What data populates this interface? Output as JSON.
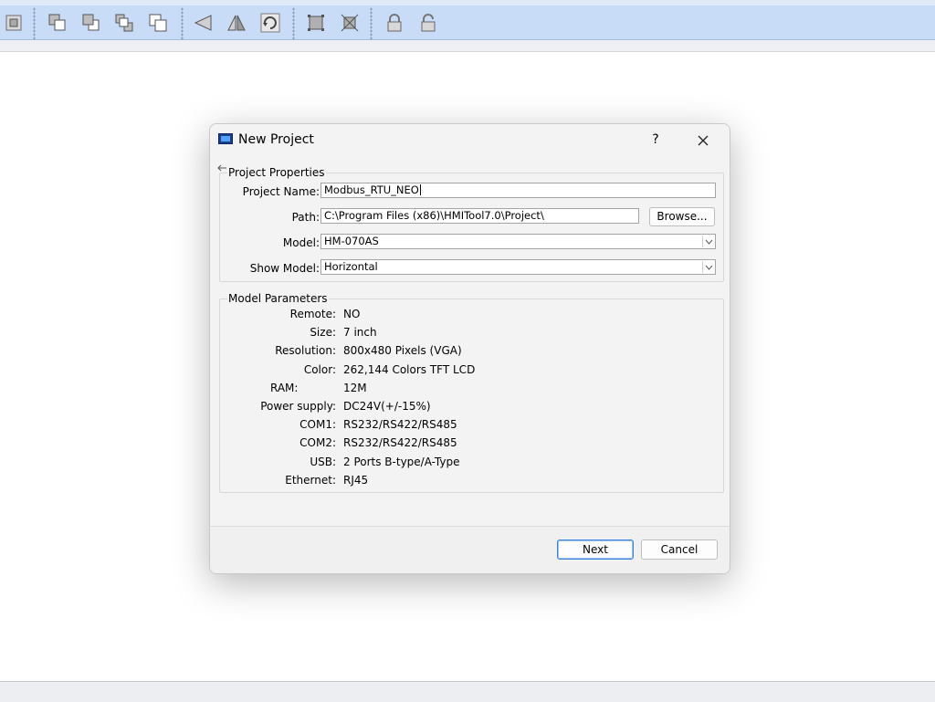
{
  "dialog": {
    "title": "New Project",
    "help_label": "?",
    "properties_group": {
      "label": "Project Properties",
      "project_name_label": "Project Name:",
      "project_name_value": "Modbus_RTU_NEO",
      "path_label": "Path:",
      "path_value": "C:\\Program Files (x86)\\HMITool7.0\\Project\\",
      "browse_label": "Browse...",
      "model_label": "Model:",
      "model_value": "HM-070AS",
      "show_model_label": "Show Model:",
      "show_model_value": "Horizontal"
    },
    "parameters_group": {
      "label": "Model Parameters",
      "items": [
        {
          "label": "Remote:",
          "value": "NO"
        },
        {
          "label": "Size:",
          "value": "7 inch"
        },
        {
          "label": "Resolution:",
          "value": "800x480 Pixels (VGA)"
        },
        {
          "label": "Color:",
          "value": "262,144 Colors TFT LCD"
        },
        {
          "label": "RAM:",
          "value": "12M"
        },
        {
          "label": "Power supply:",
          "value": "DC24V(+/-15%)"
        },
        {
          "label": "COM1:",
          "value": "RS232/RS422/RS485"
        },
        {
          "label": "COM2:",
          "value": "RS232/RS422/RS485"
        },
        {
          "label": "USB:",
          "value": "2 Ports B-type/A-Type"
        },
        {
          "label": "Ethernet:",
          "value": "RJ45"
        }
      ]
    },
    "next_label": "Next",
    "cancel_label": "Cancel"
  },
  "toolbar": {
    "icons": [
      "object-icon",
      "bring-front-icon",
      "send-back-icon",
      "bring-forward-icon",
      "send-backward-icon",
      "flip-horizontal-icon",
      "flip-vertical-icon",
      "rotate-icon",
      "group-icon",
      "ungroup-icon",
      "lock-icon",
      "unlock-icon"
    ]
  },
  "colors": {
    "toolbar_bg": "#c9dcf7",
    "primary_button_border": "#3a83d9"
  }
}
